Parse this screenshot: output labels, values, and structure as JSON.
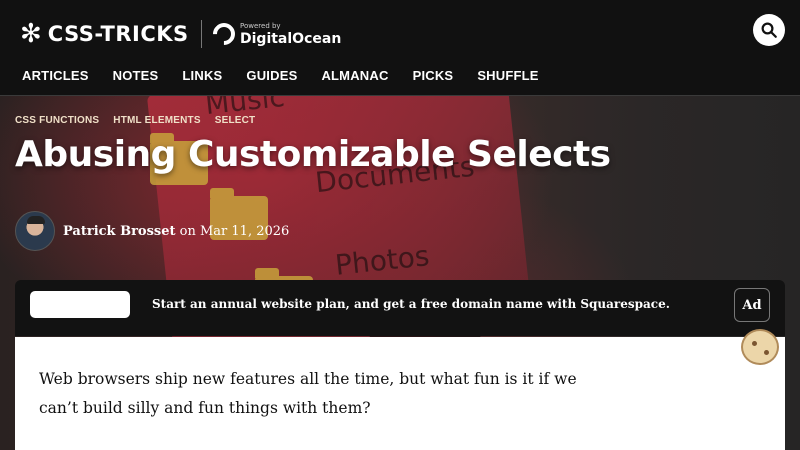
{
  "header": {
    "logo_star": "✻",
    "logo_text": "CSS-TRICKS",
    "sponsor_powered": "Powered by",
    "sponsor_name": "DigitalOcean",
    "search_icon": "search-icon"
  },
  "nav": {
    "items": [
      {
        "label": "ARTICLES"
      },
      {
        "label": "NOTES"
      },
      {
        "label": "LINKS"
      },
      {
        "label": "GUIDES"
      },
      {
        "label": "ALMANAC"
      },
      {
        "label": "PICKS"
      },
      {
        "label": "SHUFFLE"
      }
    ]
  },
  "hero": {
    "background_words": [
      "Music",
      "Documents",
      "Photos"
    ]
  },
  "article": {
    "tags": [
      {
        "label": "CSS FUNCTIONS"
      },
      {
        "label": "HTML ELEMENTS"
      },
      {
        "label": "SELECT"
      }
    ],
    "title": "Abusing Customizable Selects",
    "author": "Patrick Brosset",
    "date_prefix": "on",
    "date": "Mar 11, 2026",
    "body_first_paragraph": "Web browsers ship new features all the time, but what fun is it if we can’t build silly and fun things with them?"
  },
  "ad": {
    "text": "Start an annual website plan, and get a free domain name with Squarespace.",
    "badge": "Ad"
  },
  "colors": {
    "header_bg": "#111111",
    "tag_color": "#f0e0c8",
    "content_bg": "#ffffff",
    "ad_bg": "#121212"
  }
}
